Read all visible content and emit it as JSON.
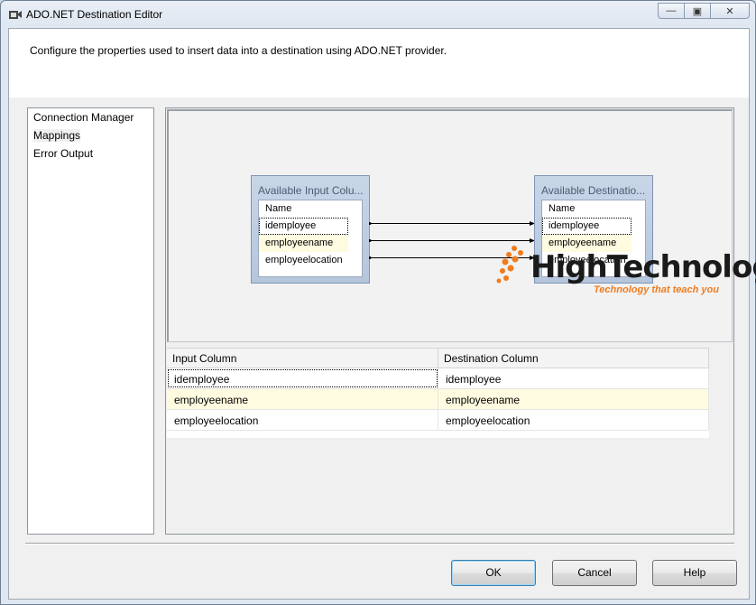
{
  "window": {
    "title": "ADO.NET Destination Editor",
    "minimize_glyph": "—",
    "restore_glyph": "▣",
    "close_glyph": "✕"
  },
  "header": {
    "description": "Configure the properties used to insert data into a destination using ADO.NET provider."
  },
  "nav": {
    "items": [
      {
        "label": "Connection Manager"
      },
      {
        "label": "Mappings"
      },
      {
        "label": "Error Output"
      }
    ],
    "selected": "Mappings"
  },
  "diagram": {
    "input_box": {
      "title": "Available Input Colu...",
      "header": "Name",
      "rows": [
        "idemployee",
        "employeename",
        "employeelocation"
      ]
    },
    "destination_box": {
      "title": "Available Destinatio...",
      "header": "Name",
      "rows": [
        "idemployee",
        "employeename",
        "employeelocation"
      ]
    }
  },
  "grid": {
    "headers": [
      "Input Column",
      "Destination Column"
    ],
    "rows": [
      [
        "idemployee",
        "idemployee"
      ],
      [
        "employeename",
        "employeename"
      ],
      [
        "employeelocation",
        "employeelocation"
      ]
    ]
  },
  "logo": {
    "name": "HighTechnology",
    "tagline": "Technology that teach you"
  },
  "buttons": {
    "ok": "OK",
    "cancel": "Cancel",
    "help": "Help"
  },
  "colors": {
    "accent_orange": "#f07c1e",
    "selection_yellow": "#fffbe0",
    "box_blue": "#b5c6dc"
  }
}
